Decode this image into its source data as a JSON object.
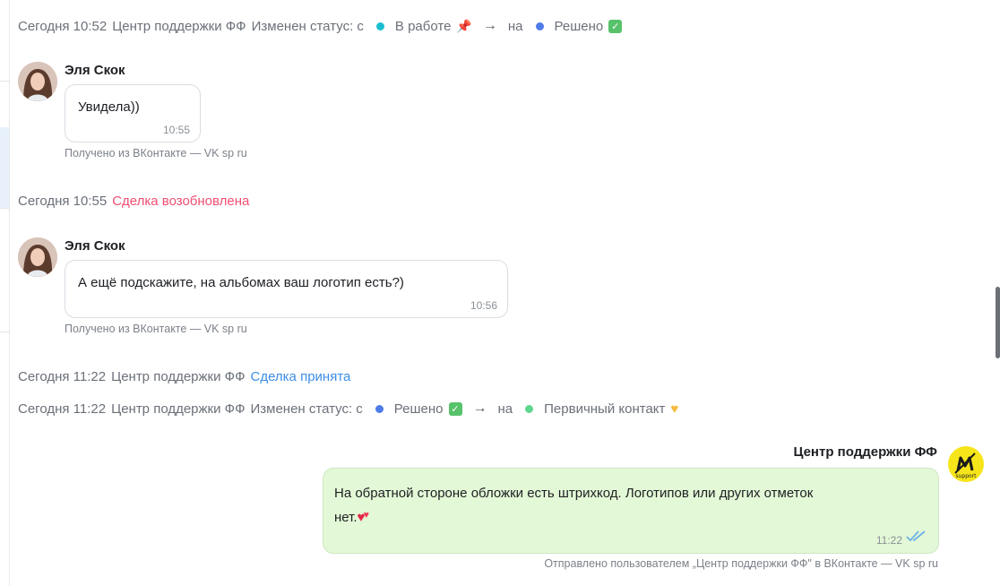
{
  "events": {
    "e1": {
      "date": "Сегодня 10:52",
      "actor": "Центр поддержки ФФ",
      "action": "Изменен статус: с",
      "from_status": "В работе",
      "to_word": "на",
      "to_status": "Решено",
      "from_color": "#1bbfd0",
      "to_color": "#4f7be8"
    },
    "e2": {
      "date": "Сегодня 10:55",
      "action": "Сделка возобновлена",
      "action_color": "#ef4f72"
    },
    "e3": {
      "date": "Сегодня 11:22",
      "actor": "Центр поддержки ФФ",
      "action": "Сделка принята",
      "action_color": "#3d8ee8"
    },
    "e4": {
      "date": "Сегодня 11:22",
      "actor": "Центр поддержки ФФ",
      "action": "Изменен статус: с",
      "from_status": "Решено",
      "to_word": "на",
      "to_status": "Первичный контакт",
      "from_color": "#4f7be8",
      "to_color": "#5fd68e"
    }
  },
  "messages": {
    "m1": {
      "sender": "Эля Скок",
      "text": "Увидела))",
      "time": "10:55",
      "source": "Получено из ВКонтакте — VK sp ru"
    },
    "m2": {
      "sender": "Эля Скок",
      "text": "А ещё подскажите, на альбомах ваш логотип есть?)",
      "time": "10:56",
      "source": "Получено из ВКонтакте — VK sp ru"
    },
    "m3": {
      "sender": "Центр поддержки ФФ",
      "text_line1": "На обратной стороне обложки есть штрихкод. Логотипов или других отметок",
      "text_line2": "нет.",
      "time": "11:22",
      "source": "Отправлено пользователем „Центр поддержки ФФ\" в ВКонтакте — VK sp ru",
      "logo_text": "support"
    }
  },
  "icons": {
    "pin": "pushpin-icon",
    "check": "check-mark-icon",
    "arrow": "→",
    "heart": "yellow-heart-icon",
    "hearts": "two-hearts-icon",
    "ticks": "double-check-icon"
  }
}
